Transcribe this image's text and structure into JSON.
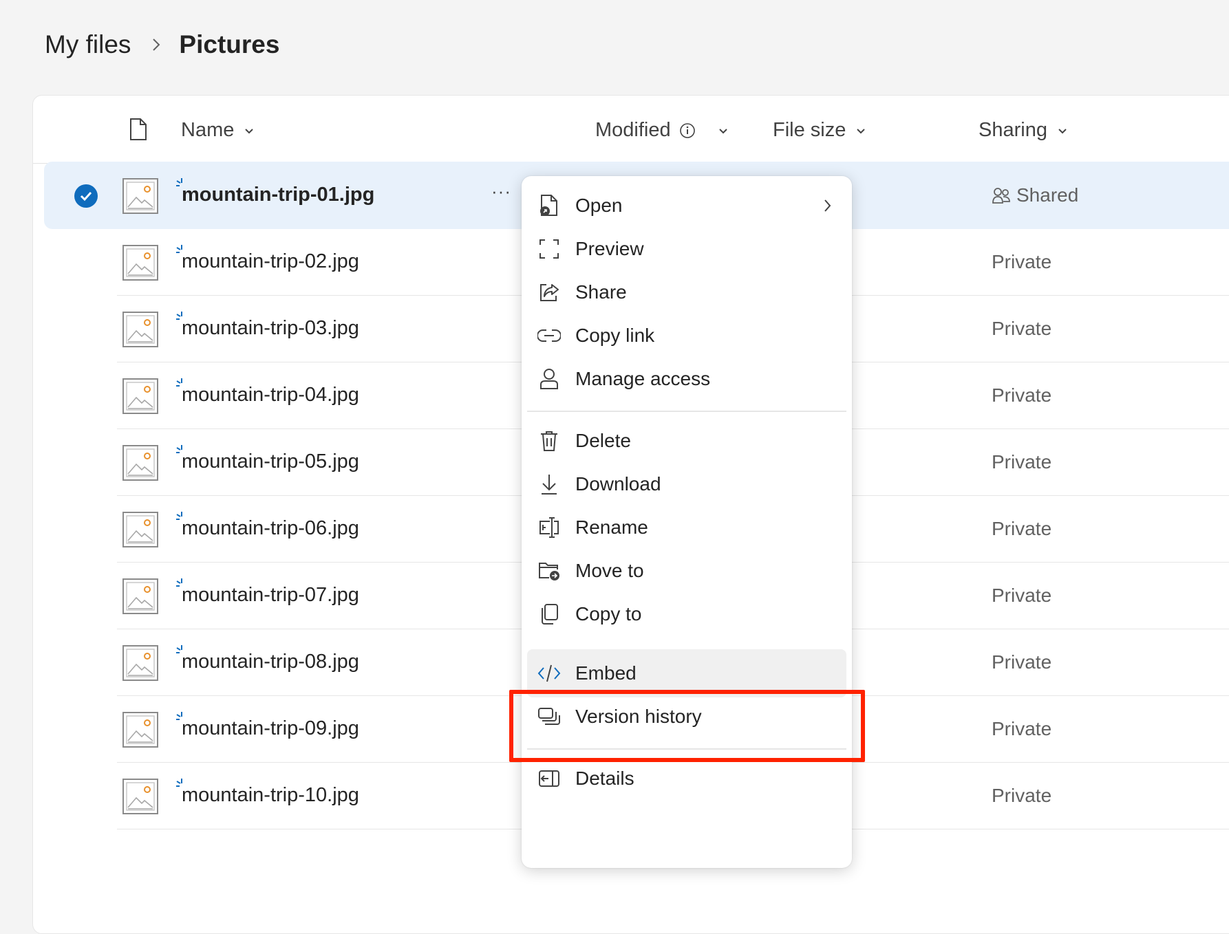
{
  "breadcrumb": {
    "root": "My files",
    "current": "Pictures"
  },
  "columns": {
    "name": "Name",
    "modified": "Modified",
    "file_size": "File size",
    "sharing": "Sharing"
  },
  "files": [
    {
      "name": "mountain-trip-01.jpg",
      "sharing": "Shared",
      "selected": true
    },
    {
      "name": "mountain-trip-02.jpg",
      "sharing": "Private"
    },
    {
      "name": "mountain-trip-03.jpg",
      "sharing": "Private"
    },
    {
      "name": "mountain-trip-04.jpg",
      "sharing": "Private"
    },
    {
      "name": "mountain-trip-05.jpg",
      "sharing": "Private"
    },
    {
      "name": "mountain-trip-06.jpg",
      "sharing": "Private"
    },
    {
      "name": "mountain-trip-07.jpg",
      "sharing": "Private"
    },
    {
      "name": "mountain-trip-08.jpg",
      "sharing": "Private"
    },
    {
      "name": "mountain-trip-09.jpg",
      "sharing": "Private"
    },
    {
      "name": "mountain-trip-10.jpg",
      "sharing": "Private"
    }
  ],
  "more_label": "···",
  "context_menu": {
    "open": "Open",
    "preview": "Preview",
    "share": "Share",
    "copy_link": "Copy link",
    "manage_access": "Manage access",
    "delete": "Delete",
    "download": "Download",
    "rename": "Rename",
    "move_to": "Move to",
    "copy_to": "Copy to",
    "embed": "Embed",
    "version_history": "Version history",
    "details": "Details"
  },
  "colors": {
    "accent": "#0f6cbd",
    "selected_row": "#e8f1fb",
    "highlight_box": "#ff2200"
  }
}
